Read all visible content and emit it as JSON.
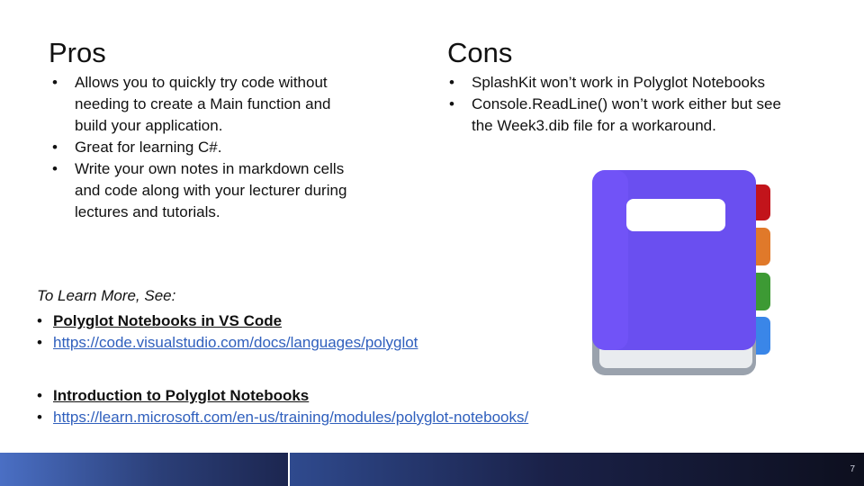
{
  "pros": {
    "heading": "Pros",
    "items": [
      "Allows you to quickly try code without needing to create a Main function and build your application.",
      "Great for learning C#.",
      "Write your own notes in markdown cells and code along with your lecturer during lectures and tutorials."
    ]
  },
  "cons": {
    "heading": "Cons",
    "items": [
      "SplashKit won’t work in Polyglot Notebooks",
      "Console.ReadLine() won’t work either but see the Week3.dib file for a workaround."
    ]
  },
  "learn_more": {
    "label": "To Learn More, See:",
    "group1": {
      "title": "Polyglot Notebooks in VS Code",
      "url": "https://code.visualstudio.com/docs/languages/polyglot"
    },
    "group2": {
      "title": "Introduction to Polyglot Notebooks",
      "url": "https://learn.microsoft.com/en-us/training/modules/polyglot-notebooks/"
    }
  },
  "icon": "notebook-icon",
  "colors": {
    "link": "#2f5fbd",
    "notebook_cover": "#6a4ff0",
    "tab_red": "#c2141b",
    "tab_orange": "#e0792a",
    "tab_green": "#3d9a34",
    "tab_blue": "#3a86e8"
  },
  "footer": {
    "page_number": "7"
  }
}
